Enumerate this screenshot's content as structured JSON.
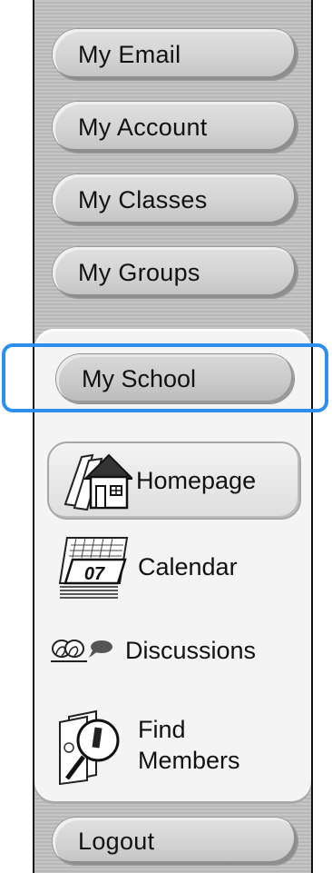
{
  "nav": {
    "items": [
      {
        "label": "My Email"
      },
      {
        "label": "My Account"
      },
      {
        "label": "My Classes"
      },
      {
        "label": "My Groups"
      }
    ],
    "school": {
      "label": "My School"
    },
    "logout": {
      "label": "Logout"
    }
  },
  "school_menu": {
    "homepage": {
      "label": "Homepage",
      "icon": "house-icon"
    },
    "calendar": {
      "label": "Calendar",
      "icon": "calendar-icon",
      "icon_text": "07"
    },
    "discussions": {
      "label": "Discussions",
      "icon": "speech-bubbles-icon"
    },
    "find_members": {
      "label_line1": "Find",
      "label_line2": "Members",
      "icon": "magnifier-profile-icon"
    }
  },
  "colors": {
    "selection": "#2f8dee",
    "panel_stripe_light": "#c6c6c6",
    "panel_stripe_dark": "#b7b7b7",
    "expanded_bg": "#f4f4f4"
  }
}
